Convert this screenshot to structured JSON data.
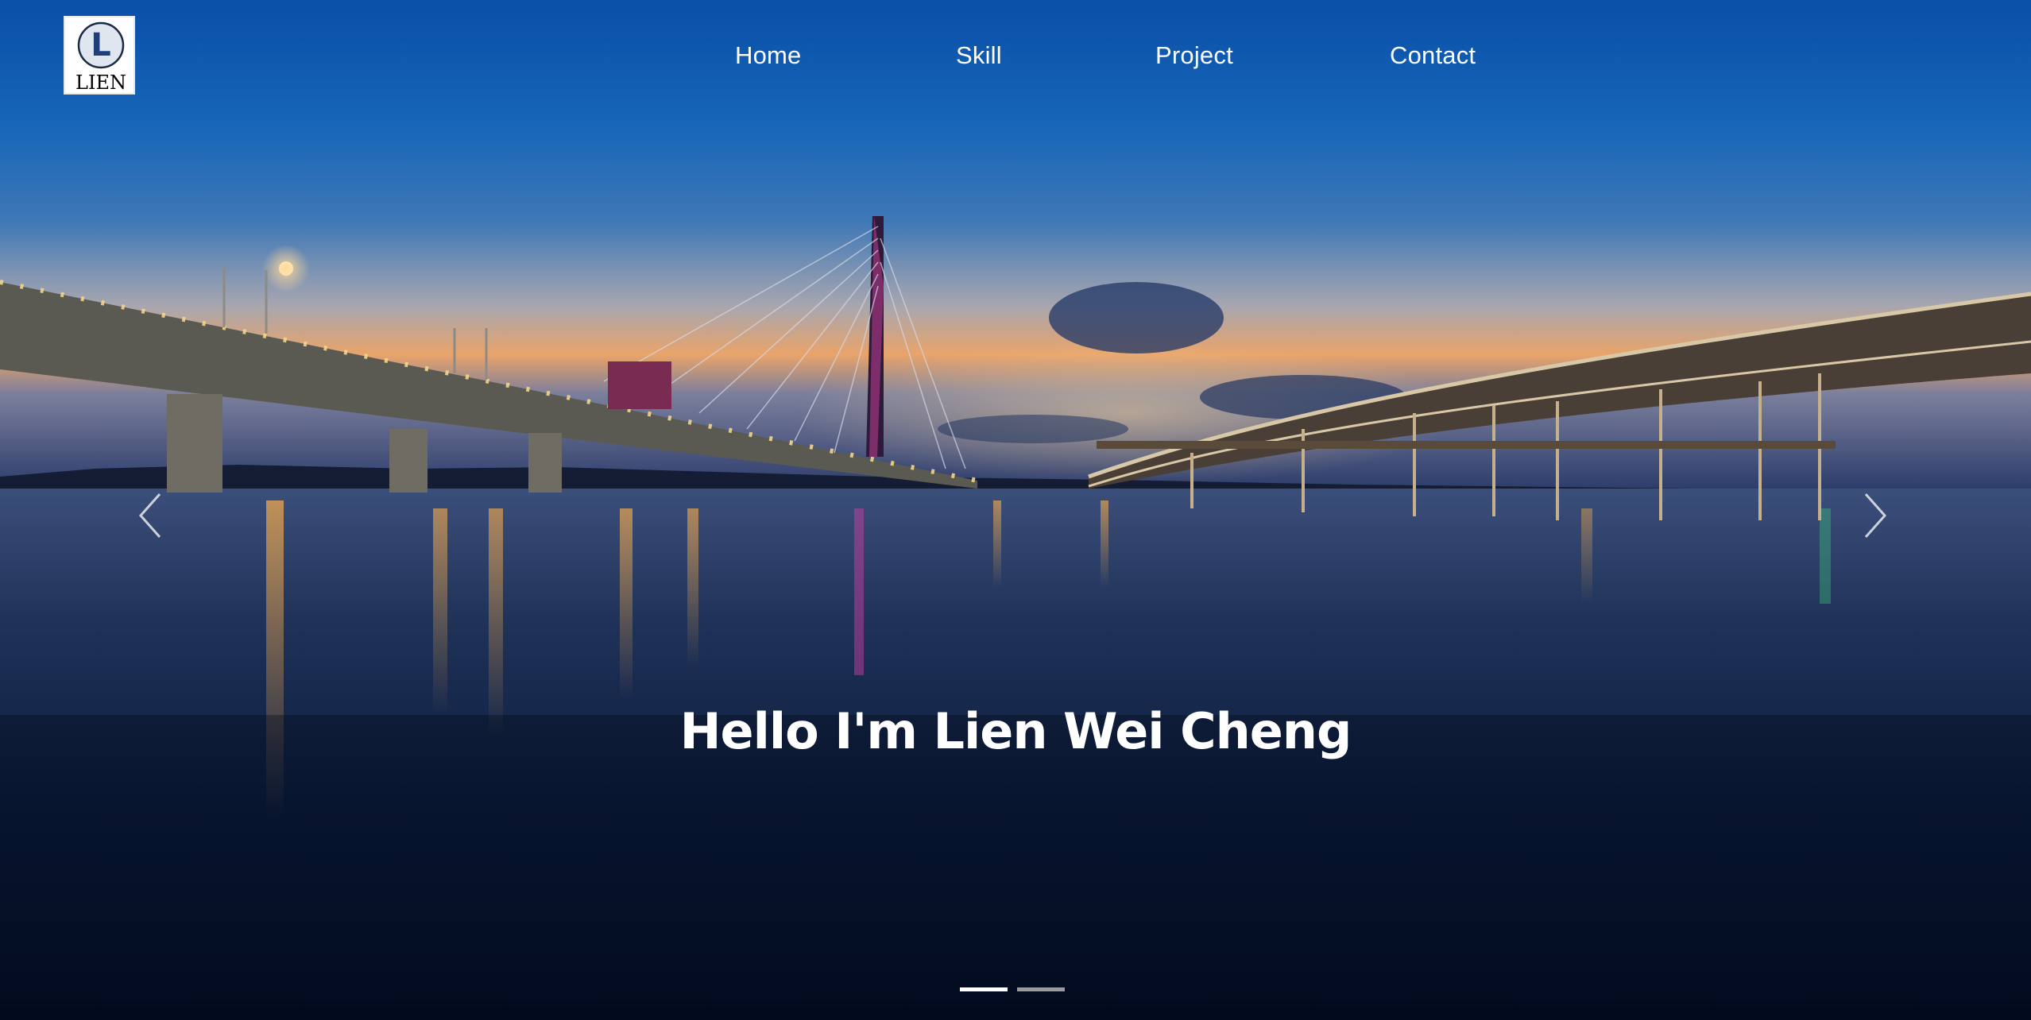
{
  "logo": {
    "letter": "L",
    "text": "LIEN"
  },
  "nav": {
    "items": [
      {
        "label": "Home"
      },
      {
        "label": "Skill"
      },
      {
        "label": "Project"
      },
      {
        "label": "Contact"
      }
    ]
  },
  "hero": {
    "headline": "Hello I'm Lien Wei Cheng",
    "active_slide": 1,
    "slide_count": 2
  },
  "colors": {
    "sky_top": "#0a4fa8",
    "sky_horizon": "#e9a46a",
    "water": "#061631",
    "indicator_active": "#ffffff",
    "indicator_inactive": "#9a9a9a"
  }
}
